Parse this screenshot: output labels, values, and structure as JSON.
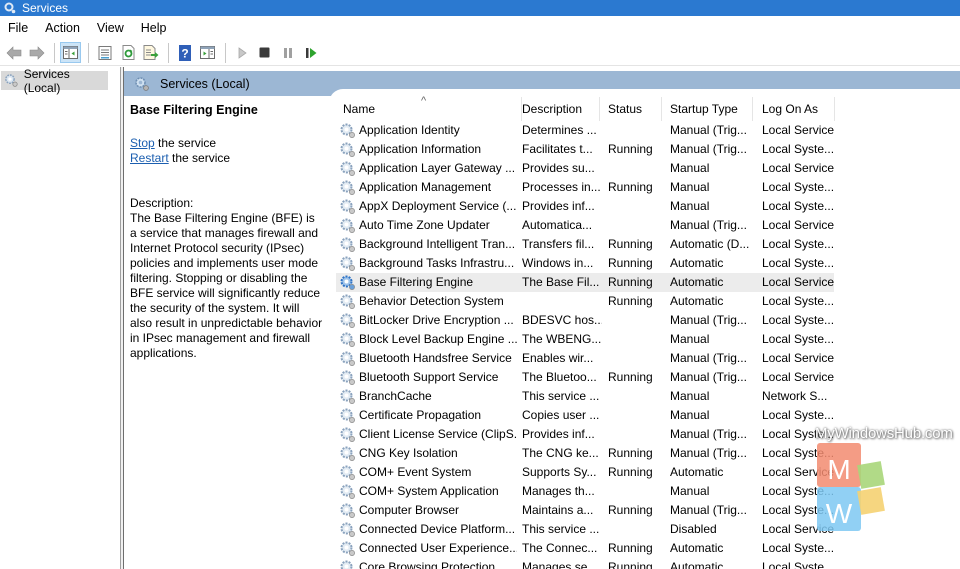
{
  "window": {
    "title": "Services",
    "icon": "services-gear-icon"
  },
  "menu": [
    "File",
    "Action",
    "View",
    "Help"
  ],
  "toolbar": {
    "buttons": [
      {
        "name": "back",
        "icon": "back-arrow-icon"
      },
      {
        "name": "forward",
        "icon": "forward-arrow-icon"
      },
      {
        "name": "show-hide-console-tree",
        "icon": "console-tree-icon",
        "active": true
      },
      {
        "name": "properties",
        "icon": "properties-icon"
      },
      {
        "name": "refresh",
        "icon": "refresh-icon"
      },
      {
        "name": "export-list",
        "icon": "export-list-icon"
      },
      {
        "name": "help",
        "icon": "help-icon"
      },
      {
        "name": "show-hide-action-pane",
        "icon": "action-pane-icon"
      },
      {
        "name": "start-service",
        "icon": "play-icon"
      },
      {
        "name": "stop-service",
        "icon": "stop-icon"
      },
      {
        "name": "pause-service",
        "icon": "pause-icon"
      },
      {
        "name": "restart-service",
        "icon": "restart-icon"
      }
    ]
  },
  "tree": {
    "selected": "Services (Local)"
  },
  "main": {
    "header": "Services (Local)",
    "extended": {
      "service_name": "Base Filtering Engine",
      "stop_link": "Stop",
      "stop_suffix": " the service",
      "restart_link": "Restart",
      "restart_suffix": " the service",
      "description_label": "Description:",
      "description": "The Base Filtering Engine (BFE) is a service that manages firewall and Internet Protocol security (IPsec) policies and implements user mode filtering. Stopping or disabling the BFE service will significantly reduce the security of the system. It will also result in unpredictable behavior in IPsec management and firewall applications."
    },
    "columns": [
      "Name",
      "Description",
      "Status",
      "Startup Type",
      "Log On As"
    ],
    "sort_column": "Name",
    "sort_direction": "ascending",
    "selected_row": "Base Filtering Engine",
    "rows": [
      {
        "name": "Application Identity",
        "desc": "Determines ...",
        "status": "",
        "startup": "Manual (Trig...",
        "logon": "Local Service"
      },
      {
        "name": "Application Information",
        "desc": "Facilitates t...",
        "status": "Running",
        "startup": "Manual (Trig...",
        "logon": "Local Syste..."
      },
      {
        "name": "Application Layer Gateway ...",
        "desc": "Provides su...",
        "status": "",
        "startup": "Manual",
        "logon": "Local Service"
      },
      {
        "name": "Application Management",
        "desc": "Processes in...",
        "status": "Running",
        "startup": "Manual",
        "logon": "Local Syste..."
      },
      {
        "name": "AppX Deployment Service (...",
        "desc": "Provides inf...",
        "status": "",
        "startup": "Manual",
        "logon": "Local Syste..."
      },
      {
        "name": "Auto Time Zone Updater",
        "desc": "Automatica...",
        "status": "",
        "startup": "Manual (Trig...",
        "logon": "Local Service"
      },
      {
        "name": "Background Intelligent Tran...",
        "desc": "Transfers fil...",
        "status": "Running",
        "startup": "Automatic (D...",
        "logon": "Local Syste..."
      },
      {
        "name": "Background Tasks Infrastru...",
        "desc": "Windows in...",
        "status": "Running",
        "startup": "Automatic",
        "logon": "Local Syste..."
      },
      {
        "name": "Base Filtering Engine",
        "desc": "The Base Fil...",
        "status": "Running",
        "startup": "Automatic",
        "logon": "Local Service"
      },
      {
        "name": "Behavior Detection System",
        "desc": "",
        "status": "Running",
        "startup": "Automatic",
        "logon": "Local Syste..."
      },
      {
        "name": "BitLocker Drive Encryption ...",
        "desc": "BDESVC hos...",
        "status": "",
        "startup": "Manual (Trig...",
        "logon": "Local Syste..."
      },
      {
        "name": "Block Level Backup Engine ...",
        "desc": "The WBENG...",
        "status": "",
        "startup": "Manual",
        "logon": "Local Syste..."
      },
      {
        "name": "Bluetooth Handsfree Service",
        "desc": "Enables wir...",
        "status": "",
        "startup": "Manual (Trig...",
        "logon": "Local Service"
      },
      {
        "name": "Bluetooth Support Service",
        "desc": "The Bluetoo...",
        "status": "Running",
        "startup": "Manual (Trig...",
        "logon": "Local Service"
      },
      {
        "name": "BranchCache",
        "desc": "This service ...",
        "status": "",
        "startup": "Manual",
        "logon": "Network S..."
      },
      {
        "name": "Certificate Propagation",
        "desc": "Copies user ...",
        "status": "",
        "startup": "Manual",
        "logon": "Local Syste..."
      },
      {
        "name": "Client License Service (ClipS...",
        "desc": "Provides inf...",
        "status": "",
        "startup": "Manual (Trig...",
        "logon": "Local Syste..."
      },
      {
        "name": "CNG Key Isolation",
        "desc": "The CNG ke...",
        "status": "Running",
        "startup": "Manual (Trig...",
        "logon": "Local Syste..."
      },
      {
        "name": "COM+ Event System",
        "desc": "Supports Sy...",
        "status": "Running",
        "startup": "Automatic",
        "logon": "Local Service"
      },
      {
        "name": "COM+ System Application",
        "desc": "Manages th...",
        "status": "",
        "startup": "Manual",
        "logon": "Local Syste..."
      },
      {
        "name": "Computer Browser",
        "desc": "Maintains a...",
        "status": "Running",
        "startup": "Manual (Trig...",
        "logon": "Local Syste..."
      },
      {
        "name": "Connected Device Platform...",
        "desc": "This service ...",
        "status": "",
        "startup": "Disabled",
        "logon": "Local Service"
      },
      {
        "name": "Connected User Experience...",
        "desc": "The Connec...",
        "status": "Running",
        "startup": "Automatic",
        "logon": "Local Syste..."
      },
      {
        "name": "Core Browsing Protection",
        "desc": "Manages se...",
        "status": "Running",
        "startup": "Automatic",
        "logon": "Local Syste..."
      }
    ]
  },
  "watermark": {
    "text": "MyWindowsHub.com",
    "logo_letters": [
      "M",
      "W"
    ],
    "colors": [
      "#f28b70",
      "#a8d67a",
      "#7ec8f2",
      "#f5d272"
    ]
  },
  "theme": {
    "titlebar": "#2b79d0",
    "header_band": "#9cb7d4",
    "link": "#1c5fb0",
    "selected_row": "#ececec"
  }
}
